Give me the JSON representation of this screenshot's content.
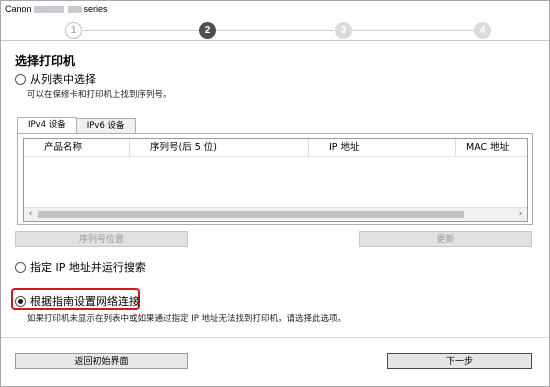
{
  "window": {
    "title_prefix": "Canon",
    "title_suffix": "series"
  },
  "steps": [
    "1",
    "2",
    "3",
    "4"
  ],
  "section_title": "选择打印机",
  "option_list": {
    "label": "从列表中选择",
    "hint": "可以在保修卡和打印机上找到序列号。"
  },
  "tabs": [
    "IPv4 设备",
    "IPv6 设备"
  ],
  "table": {
    "columns": [
      "产品名称",
      "序列号(后 5 位)",
      "IP 地址",
      "MAC 地址"
    ],
    "scroll_left": "‹",
    "scroll_right": "›"
  },
  "buttons": {
    "serial_location": "序列号位置",
    "update": "更新",
    "back_to_start": "返回初始界面",
    "next": "下一步"
  },
  "option_ip": {
    "label": "指定 IP 地址并运行搜索"
  },
  "option_guide": {
    "label": "根据指南设置网络连接",
    "hint": "如果打印机未显示在列表中或如果通过指定 IP 地址无法找到打印机，请选择此选项。",
    "selected": true
  },
  "colors": {
    "highlight_border": "#d01818",
    "active_step": "#4f4f4f"
  }
}
